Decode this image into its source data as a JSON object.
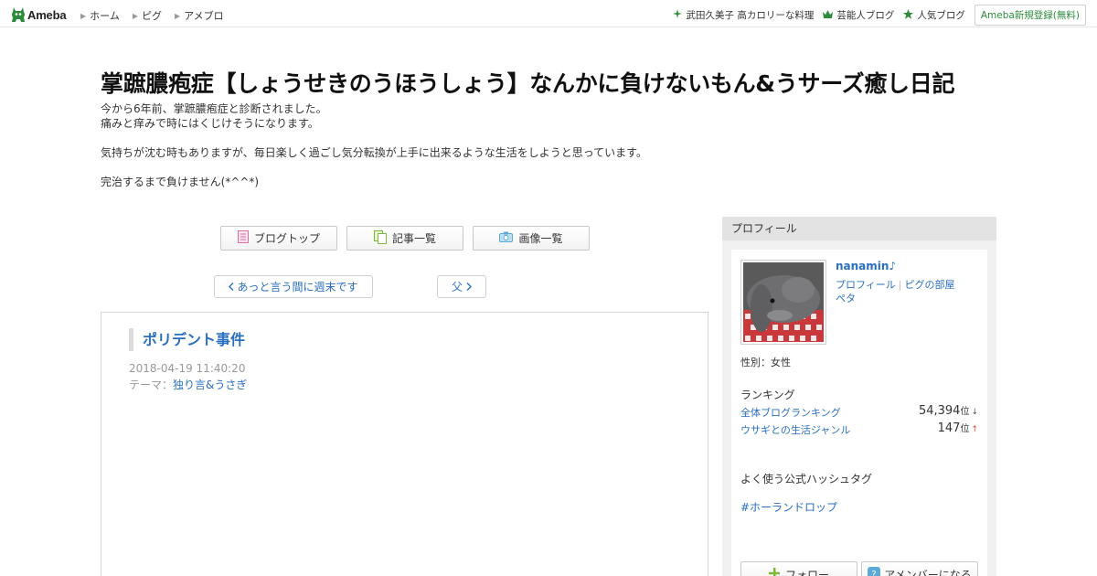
{
  "header": {
    "logo_text": "Ameba",
    "nav": [
      {
        "label": "ホーム"
      },
      {
        "label": "ピグ"
      },
      {
        "label": "アメブロ"
      }
    ],
    "right_links": [
      {
        "label": "武田久美子 高カロリーな料理",
        "icon": "sparkle-icon"
      },
      {
        "label": "芸能人ブログ",
        "icon": "crown-icon"
      },
      {
        "label": "人気ブログ",
        "icon": "star-icon"
      }
    ],
    "signup_label": "Ameba新規登録(無料)"
  },
  "blog": {
    "title": "掌蹠膿疱症【しょうせきのうほうしょう】なんかに負けないもん&うサーズ癒し日記",
    "description": [
      "今から6年前、掌蹠膿疱症と診断されました。",
      "痛みと痒みで時にはくじけそうになります。",
      "",
      "気持ちが沈む時もありますが、毎日楽しく過ごし気分転換が上手に出来るような生活をしようと思っています。",
      "",
      "完治するまで負けません(*^^*)"
    ]
  },
  "blog_nav": {
    "top_label": "ブログトップ",
    "list_label": "記事一覧",
    "images_label": "画像一覧"
  },
  "pager": {
    "prev_label": "あっと言う間に週末です",
    "next_label": "父"
  },
  "article": {
    "title": "ポリデント事件",
    "date": "2018-04-19 11:40:20",
    "theme_prefix": "テーマ：",
    "theme": "独り言&うさぎ"
  },
  "sidebar": {
    "heading": "プロフィール",
    "name": "nanamin♪",
    "links": [
      "プロフィール",
      "ピグの部屋",
      "ペタ"
    ],
    "gender": "性別：女性",
    "ranking_label": "ランキング",
    "rankings": [
      {
        "name": "全体ブログランキング",
        "value": "54,394",
        "unit": "位",
        "trend": "↓"
      },
      {
        "name": "ウサギとの生活ジャンル",
        "value": "147",
        "unit": "位",
        "trend": "↑"
      }
    ],
    "hashtag_label": "よく使う公式ハッシュタグ",
    "hashtag": "#ホーランドロップ",
    "follow_label": "フォロー",
    "member_label": "アメンバーになる"
  },
  "colors": {
    "link": "#2a6fbf",
    "brand_green": "#2d8c3c",
    "rank_up": "#e0413a"
  }
}
